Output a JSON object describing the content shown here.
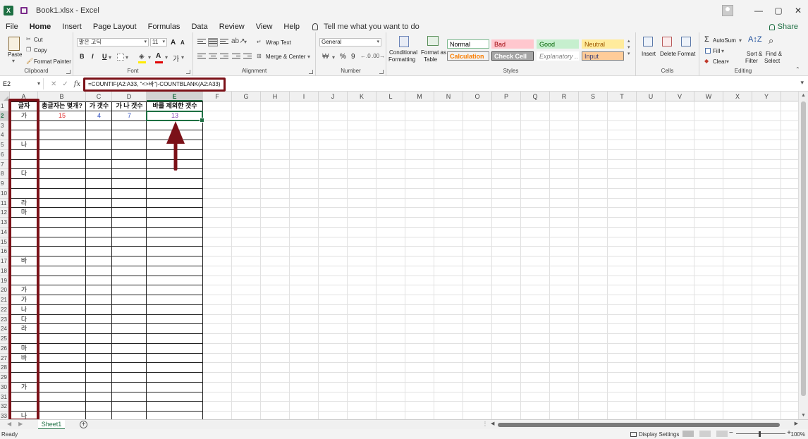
{
  "window": {
    "title": "Book1.xlsx  -  Excel"
  },
  "menu": {
    "tabs": [
      "File",
      "Home",
      "Insert",
      "Page Layout",
      "Formulas",
      "Data",
      "Review",
      "View",
      "Help"
    ],
    "active": "Home",
    "tell_me": "Tell me what you want to do",
    "share": "Share"
  },
  "ribbon": {
    "clipboard": {
      "label": "Clipboard",
      "paste": "Paste",
      "cut": "Cut",
      "copy": "Copy",
      "format_painter": "Format Painter"
    },
    "font": {
      "label": "Font",
      "name": "맑은 고딕",
      "size": "11",
      "bold": "B",
      "italic": "I",
      "underline": "U",
      "grow": "A",
      "shrink": "A"
    },
    "alignment": {
      "label": "Alignment",
      "wrap_text": "Wrap Text",
      "merge_center": "Merge & Center"
    },
    "number": {
      "label": "Number",
      "format": "General",
      "percent": "%",
      "comma": "9"
    },
    "styles": {
      "label": "Styles",
      "conditional_formatting": [
        "Conditional",
        "Formatting"
      ],
      "format_as_table": [
        "Format as",
        "Table"
      ],
      "cells": [
        {
          "name": "Normal",
          "bg": "#ffffff",
          "fg": "#000000",
          "border": "#7cb98e"
        },
        {
          "name": "Bad",
          "bg": "#ffc7ce",
          "fg": "#9c0006",
          "border": "#ffc7ce"
        },
        {
          "name": "Good",
          "bg": "#c6efce",
          "fg": "#006100",
          "border": "#c6efce"
        },
        {
          "name": "Neutral",
          "bg": "#ffeb9c",
          "fg": "#9c5700",
          "border": "#ffeb9c"
        },
        {
          "name": "Calculation",
          "bg": "#f2f2f2",
          "fg": "#fa7d00",
          "border": "#7f7f7f"
        },
        {
          "name": "Check Cell",
          "bg": "#a5a5a5",
          "fg": "#ffffff",
          "border": "#3f3f3f"
        },
        {
          "name": "Explanatory ...",
          "bg": "#ffffff",
          "fg": "#7f7f7f",
          "border": "#ffffff"
        },
        {
          "name": "Input",
          "bg": "#ffcc99",
          "fg": "#3f3f76",
          "border": "#7f7f7f"
        }
      ]
    },
    "cells": {
      "label": "Cells",
      "insert": "Insert",
      "delete": "Delete",
      "format": "Format"
    },
    "editing": {
      "label": "Editing",
      "autosum": "AutoSum",
      "fill": "Fill",
      "clear": "Clear",
      "sort_filter": [
        "Sort &",
        "Filter"
      ],
      "find_select": [
        "Find &",
        "Select"
      ]
    }
  },
  "formula_bar": {
    "name_box": "E2",
    "formula": "=COUNTIF(A2:A33, \"<>바\")-COUNTBLANK(A2:A33)"
  },
  "columns": [
    "A",
    "B",
    "C",
    "D",
    "E",
    "F",
    "G",
    "H",
    "I",
    "J",
    "K",
    "L",
    "M",
    "N",
    "O",
    "P",
    "Q",
    "R",
    "S",
    "T",
    "U",
    "V",
    "W",
    "X",
    "Y"
  ],
  "headers": {
    "A1": "글자",
    "B1": "총글자는 몇개?",
    "C1": "가 갯수",
    "D1": "가 나 갯수",
    "E1": "바를 제외한 갯수"
  },
  "results": {
    "B2": "15",
    "C2": "4",
    "D2": "7",
    "E2": "13"
  },
  "result_colors": {
    "B2": "#e03030",
    "C2": "#3050c0",
    "D2": "#3050c0",
    "E2": "#8040b0"
  },
  "column_a": [
    {
      "row": 2,
      "value": "가"
    },
    {
      "row": 5,
      "value": "나"
    },
    {
      "row": 8,
      "value": "다"
    },
    {
      "row": 11,
      "value": "라"
    },
    {
      "row": 12,
      "value": "마"
    },
    {
      "row": 17,
      "value": "바"
    },
    {
      "row": 20,
      "value": "가"
    },
    {
      "row": 21,
      "value": "가"
    },
    {
      "row": 22,
      "value": "나"
    },
    {
      "row": 23,
      "value": "다"
    },
    {
      "row": 24,
      "value": "라"
    },
    {
      "row": 26,
      "value": "마"
    },
    {
      "row": 27,
      "value": "바"
    },
    {
      "row": 30,
      "value": "가"
    },
    {
      "row": 33,
      "value": "나"
    }
  ],
  "sheet_tabs": [
    "Sheet1"
  ],
  "status": {
    "ready": "Ready",
    "display_settings": "Display Settings",
    "zoom": "100%"
  },
  "highlight_color": "#7b1118",
  "accent": "#1d6f42"
}
